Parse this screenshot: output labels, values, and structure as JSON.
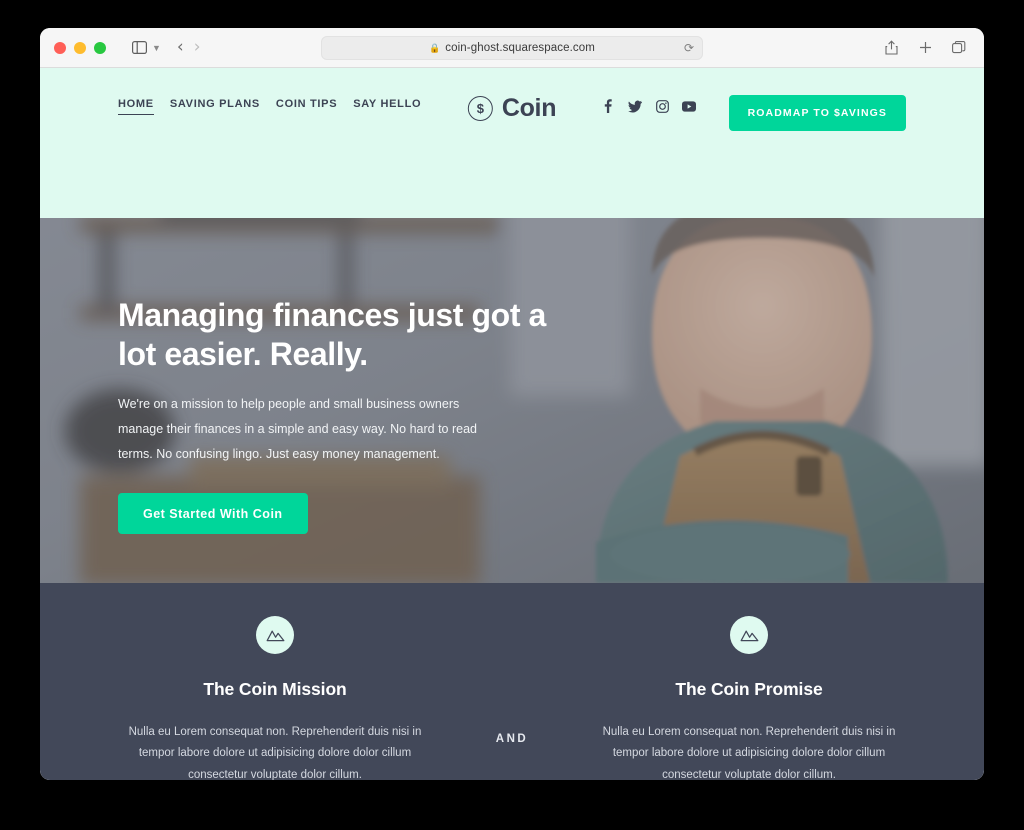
{
  "browser": {
    "url": "coin-ghost.squarespace.com",
    "lock_icon": "lock-icon",
    "reload_icon": "reload-icon",
    "sidebar_icon": "sidebar-toggle-icon",
    "back_icon": "back-chevron-icon",
    "forward_icon": "forward-chevron-icon",
    "share_icon": "share-icon",
    "new_tab_icon": "plus-icon",
    "tabs_icon": "tab-overview-icon",
    "traffic_lights": [
      "close-red",
      "minimize-yellow",
      "zoom-green"
    ]
  },
  "site": {
    "nav": [
      {
        "label": "HOME",
        "active": true
      },
      {
        "label": "SAVING PLANS",
        "active": false
      },
      {
        "label": "COIN TIPS",
        "active": false
      },
      {
        "label": "SAY HELLO",
        "active": false
      }
    ],
    "brand": {
      "mark": "$",
      "name": "Coin"
    },
    "social": [
      {
        "name": "facebook-icon"
      },
      {
        "name": "twitter-icon"
      },
      {
        "name": "instagram-icon"
      },
      {
        "name": "youtube-icon"
      }
    ],
    "header_cta": "ROADMAP TO $AVINGS",
    "hero": {
      "title": "Managing finances just got a lot easier. Really.",
      "subtitle": "We're on a mission to help people and small business owners manage their finances in a simple and easy way. No hard to read terms. No confusing lingo. Just easy money management.",
      "button": "Get Started With Coin"
    },
    "features": {
      "divider": "AND",
      "items": [
        {
          "icon": "mountain-icon",
          "title": "The Coin Mission",
          "body": "Nulla eu Lorem consequat non. Reprehenderit duis nisi in tempor labore dolore ut adipisicing dolore dolor cillum consectetur voluptate dolor cillum."
        },
        {
          "icon": "mountain-icon",
          "title": "The Coin Promise",
          "body": "Nulla eu Lorem consequat non. Reprehenderit duis nisi in tempor labore dolore ut adipisicing dolore dolor cillum consectetur voluptate dolor cillum."
        }
      ]
    },
    "colors": {
      "mint": "#dffaf0",
      "accent_green": "#00d69a",
      "dark_slate": "#424859",
      "ink": "#3c4354"
    }
  }
}
